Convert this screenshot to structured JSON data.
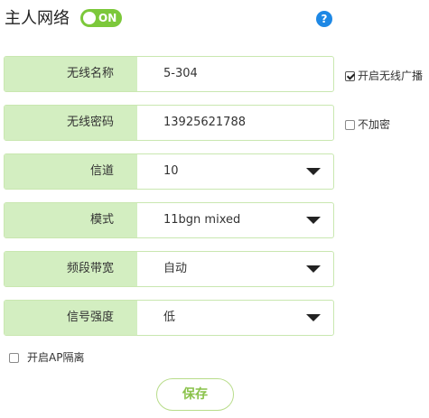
{
  "header": {
    "title": "主人网络",
    "toggle_label": "ON",
    "toggle_state": "on",
    "help_label": "?"
  },
  "colors": {
    "accent_green": "#7cc83a",
    "label_bg": "#d3eec1",
    "border_green": "#c9e7b0",
    "help_blue": "#1e88e5",
    "save_text": "#8ac24a"
  },
  "fields": {
    "ssid": {
      "label": "无线名称",
      "value": "5-304"
    },
    "password": {
      "label": "无线密码",
      "value": "13925621788"
    },
    "channel": {
      "label": "信道",
      "value": "10"
    },
    "mode": {
      "label": "模式",
      "value": "11bgn mixed"
    },
    "bandwidth": {
      "label": "频段带宽",
      "value": "自动"
    },
    "signal": {
      "label": "信号强度",
      "value": "低"
    }
  },
  "checkboxes": {
    "broadcast": {
      "label": "开启无线广播",
      "checked": true
    },
    "no_encrypt": {
      "label": "不加密",
      "checked": false
    },
    "ap_isolation": {
      "label": "开启AP隔离",
      "checked": false
    }
  },
  "actions": {
    "save_label": "保存"
  }
}
